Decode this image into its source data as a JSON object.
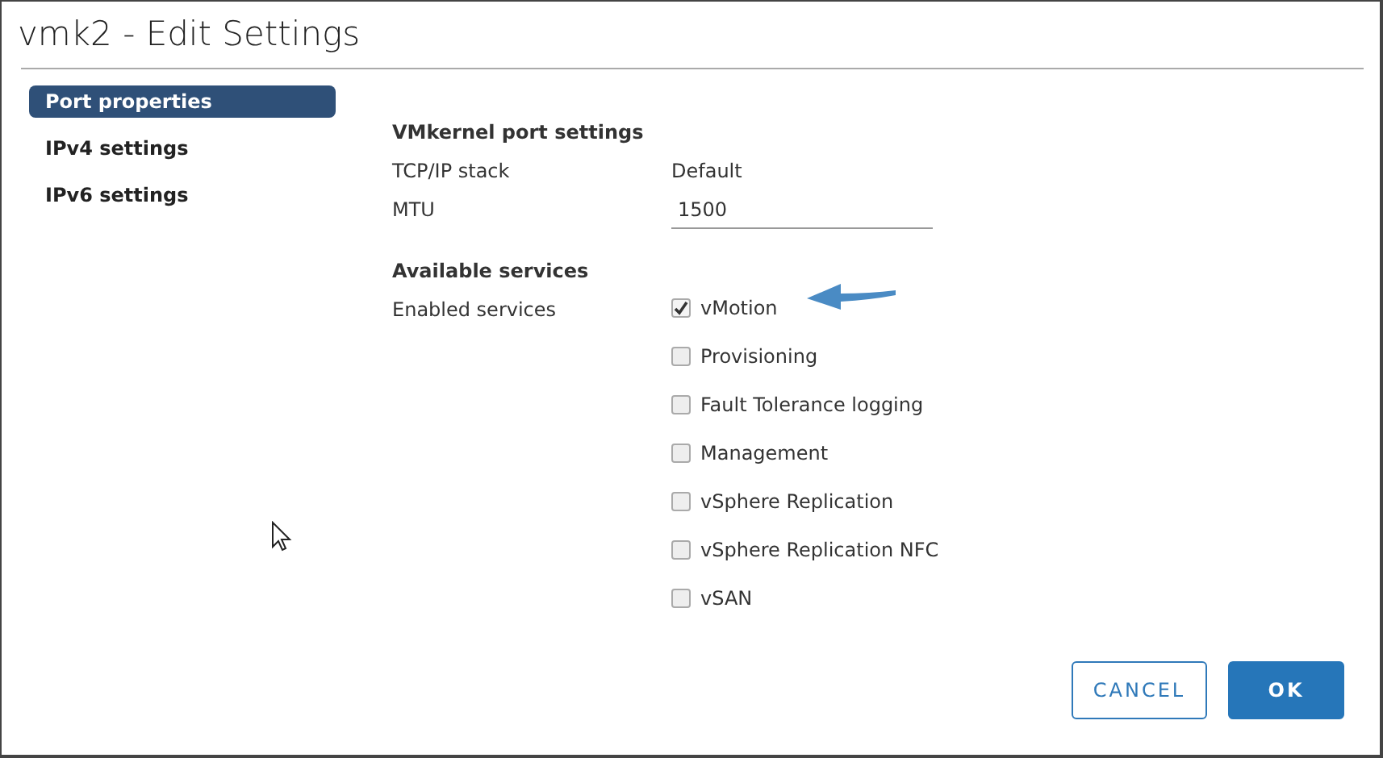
{
  "window": {
    "title": "vmk2 - Edit Settings"
  },
  "sidebar": {
    "items": [
      {
        "label": "Port properties",
        "selected": true
      },
      {
        "label": "IPv4 settings",
        "selected": false
      },
      {
        "label": "IPv6 settings",
        "selected": false
      }
    ]
  },
  "port_settings": {
    "heading": "VMkernel port settings",
    "tcpip_label": "TCP/IP stack",
    "tcpip_value": "Default",
    "mtu_label": "MTU",
    "mtu_value": "1500"
  },
  "services": {
    "heading": "Available services",
    "label": "Enabled services",
    "items": [
      {
        "label": "vMotion",
        "checked": true
      },
      {
        "label": "Provisioning",
        "checked": false
      },
      {
        "label": "Fault Tolerance logging",
        "checked": false
      },
      {
        "label": "Management",
        "checked": false
      },
      {
        "label": "vSphere Replication",
        "checked": false
      },
      {
        "label": "vSphere Replication NFC",
        "checked": false
      },
      {
        "label": "vSAN",
        "checked": false
      }
    ]
  },
  "buttons": [
    {
      "label": "CANCEL",
      "kind": "secondary"
    },
    {
      "label": "OK",
      "kind": "primary"
    }
  ]
}
